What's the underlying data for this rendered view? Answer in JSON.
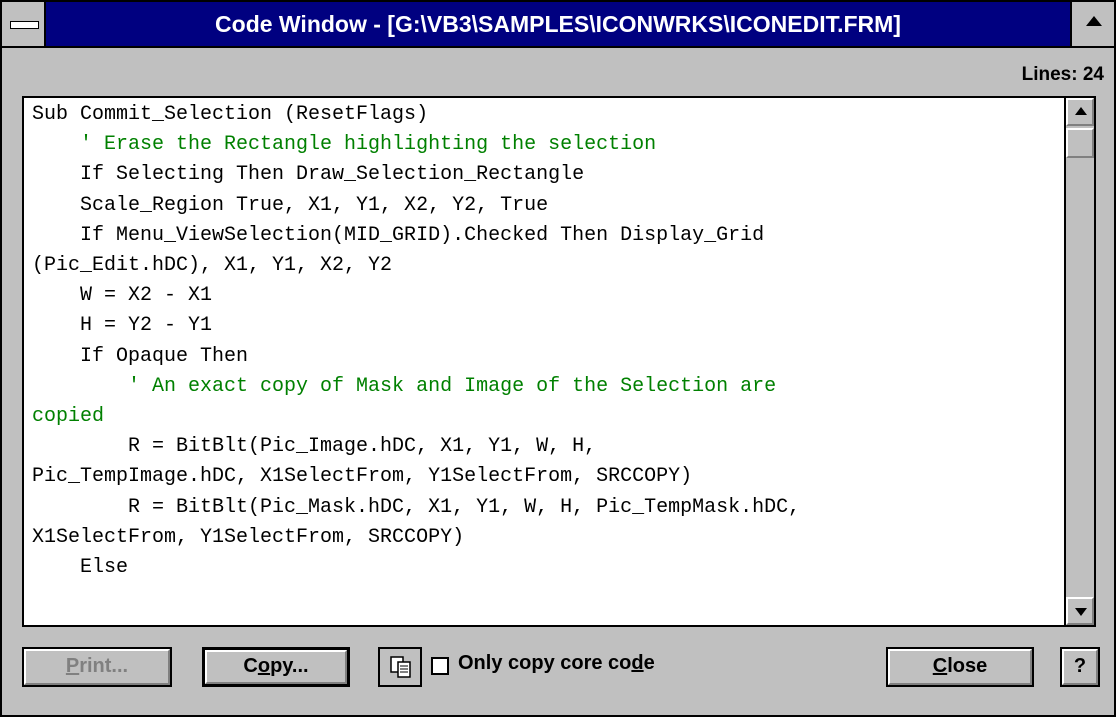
{
  "window": {
    "title": "Code Window - [G:\\VB3\\SAMPLES\\ICONWRKS\\ICONEDIT.FRM]",
    "lines_label": "Lines: 24"
  },
  "code": {
    "lines": [
      {
        "text": "Sub Commit_Selection (ResetFlags)",
        "comment": false
      },
      {
        "text": "    ' Erase the Rectangle highlighting the selection",
        "comment": true
      },
      {
        "text": "    If Selecting Then Draw_Selection_Rectangle",
        "comment": false
      },
      {
        "text": "    Scale_Region True, X1, Y1, X2, Y2, True",
        "comment": false
      },
      {
        "text": "    If Menu_ViewSelection(MID_GRID).Checked Then Display_Grid",
        "comment": false
      },
      {
        "text": "(Pic_Edit.hDC), X1, Y1, X2, Y2",
        "comment": false
      },
      {
        "text": "    W = X2 - X1",
        "comment": false
      },
      {
        "text": "    H = Y2 - Y1",
        "comment": false
      },
      {
        "text": "    If Opaque Then",
        "comment": false
      },
      {
        "text": "        ' An exact copy of Mask and Image of the Selection are",
        "comment": true
      },
      {
        "text": "copied",
        "comment": true
      },
      {
        "text": "        R = BitBlt(Pic_Image.hDC, X1, Y1, W, H,",
        "comment": false
      },
      {
        "text": "Pic_TempImage.hDC, X1SelectFrom, Y1SelectFrom, SRCCOPY)",
        "comment": false
      },
      {
        "text": "        R = BitBlt(Pic_Mask.hDC, X1, Y1, W, H, Pic_TempMask.hDC,",
        "comment": false
      },
      {
        "text": "X1SelectFrom, Y1SelectFrom, SRCCOPY)",
        "comment": false
      },
      {
        "text": "    Else",
        "comment": false
      }
    ]
  },
  "buttons": {
    "print": {
      "pre": "",
      "ul": "P",
      "post": "rint..."
    },
    "copy": {
      "pre": "C",
      "ul": "o",
      "post": "py..."
    },
    "close": {
      "pre": "",
      "ul": "C",
      "post": "lose"
    },
    "help": "?"
  },
  "options": {
    "only_copy_core": {
      "pre": "Only copy core co",
      "ul": "d",
      "post": "e",
      "checked": false
    }
  },
  "colors": {
    "title_bar": "#000080",
    "comment_text": "#008000",
    "face": "#c0c0c0"
  },
  "icons": [
    "system-menu-icon",
    "scroll-up-arrow-icon",
    "scroll-down-arrow-icon",
    "copy-clipboard-icon"
  ]
}
